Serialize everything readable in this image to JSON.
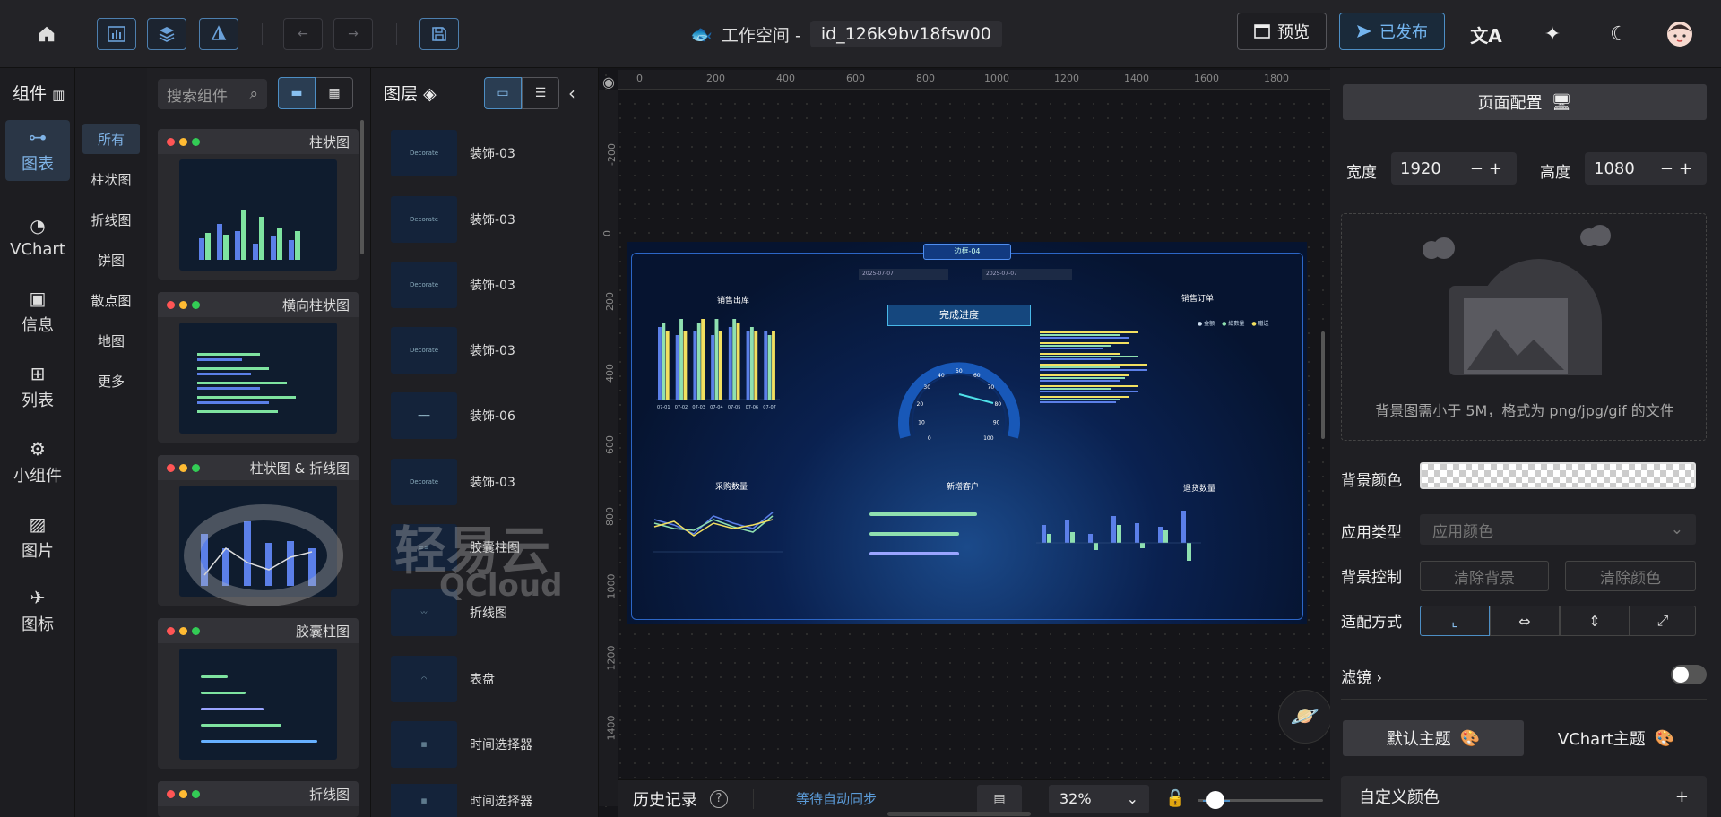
{
  "topbar": {
    "workspace_label": "工作空间 -",
    "workspace_id": "id_126k9bv18fsw00",
    "preview_label": "预览",
    "publish_label": "已发布"
  },
  "rail": {
    "header": "组件",
    "items": [
      {
        "label": "图表",
        "icon": "chart-icon"
      },
      {
        "label": "VChart",
        "icon": "vchart-icon"
      },
      {
        "label": "信息",
        "icon": "info-icon"
      },
      {
        "label": "列表",
        "icon": "table-icon"
      },
      {
        "label": "小组件",
        "icon": "widget-icon"
      },
      {
        "label": "图片",
        "icon": "image-icon"
      },
      {
        "label": "图标",
        "icon": "plane-icon"
      }
    ]
  },
  "subcats": [
    "所有",
    "柱状图",
    "折线图",
    "饼图",
    "散点图",
    "地图",
    "更多"
  ],
  "search": {
    "placeholder": "搜索组件"
  },
  "cards": [
    {
      "title": "柱状图"
    },
    {
      "title": "横向柱状图"
    },
    {
      "title": "柱状图 & 折线图"
    },
    {
      "title": "胶囊柱图"
    },
    {
      "title": "折线图"
    }
  ],
  "layers": {
    "header": "图层",
    "items": [
      "装饰-03",
      "装饰-03",
      "装饰-03",
      "装饰-03",
      "装饰-06",
      "装饰-03",
      "胶囊柱图",
      "折线图",
      "表盘",
      "时间选择器",
      "时间选择器"
    ]
  },
  "rulers": {
    "h": [
      "0",
      "200",
      "400",
      "600",
      "800",
      "1000",
      "1200",
      "1400",
      "1600",
      "1800"
    ],
    "v": [
      "-200",
      "0",
      "200",
      "400",
      "600",
      "800",
      "1000",
      "1200",
      "1400"
    ]
  },
  "screen": {
    "top_tag": "边框-04",
    "date1": "2025-07-07",
    "date2": "2025-07-07",
    "progress_title": "完成进度",
    "panels": [
      "销售出库",
      "销售订单",
      "采购数量",
      "新增客户",
      "退货数量"
    ],
    "legend": [
      "金额",
      "総數量",
      "贈送"
    ],
    "gauge_ticks": [
      "0",
      "10",
      "20",
      "30",
      "40",
      "50",
      "60",
      "70",
      "80",
      "90",
      "100"
    ],
    "chart_data": {
      "type": "bar",
      "title": "销售出库",
      "categories": [
        "07-01",
        "07-02",
        "07-03",
        "07-04",
        "07-05",
        "07-06",
        "07-07"
      ],
      "series": [
        {
          "name": "金额",
          "values": [
            180,
            160,
            170,
            160,
            180,
            170,
            170
          ]
        },
        {
          "name": "総數量",
          "values": [
            190,
            200,
            190,
            200,
            200,
            180,
            160
          ]
        },
        {
          "name": "贈送",
          "values": [
            170,
            170,
            200,
            170,
            190,
            170,
            170
          ]
        }
      ],
      "ylim": [
        0,
        200
      ]
    }
  },
  "watermark": {
    "cn": "轻易云",
    "en": "QCloud"
  },
  "right": {
    "page_config": "页面配置",
    "width_label": "宽度",
    "width_value": "1920",
    "height_label": "高度",
    "height_value": "1080",
    "bg_hint": "背景图需小于 5M，格式为 png/jpg/gif 的文件",
    "bg_color_label": "背景颜色",
    "app_type_label": "应用类型",
    "app_type_value": "应用颜色",
    "bg_control_label": "背景控制",
    "clear_bg": "清除背景",
    "clear_color": "清除颜色",
    "fit_label": "适配方式",
    "filter_label": "滤镜",
    "theme_default": "默认主题",
    "theme_vchart": "VChart主题",
    "custom_color": "自定义颜色"
  },
  "bottom": {
    "history": "历史记录",
    "sync_status": "等待自动同步",
    "zoom": "32%"
  }
}
